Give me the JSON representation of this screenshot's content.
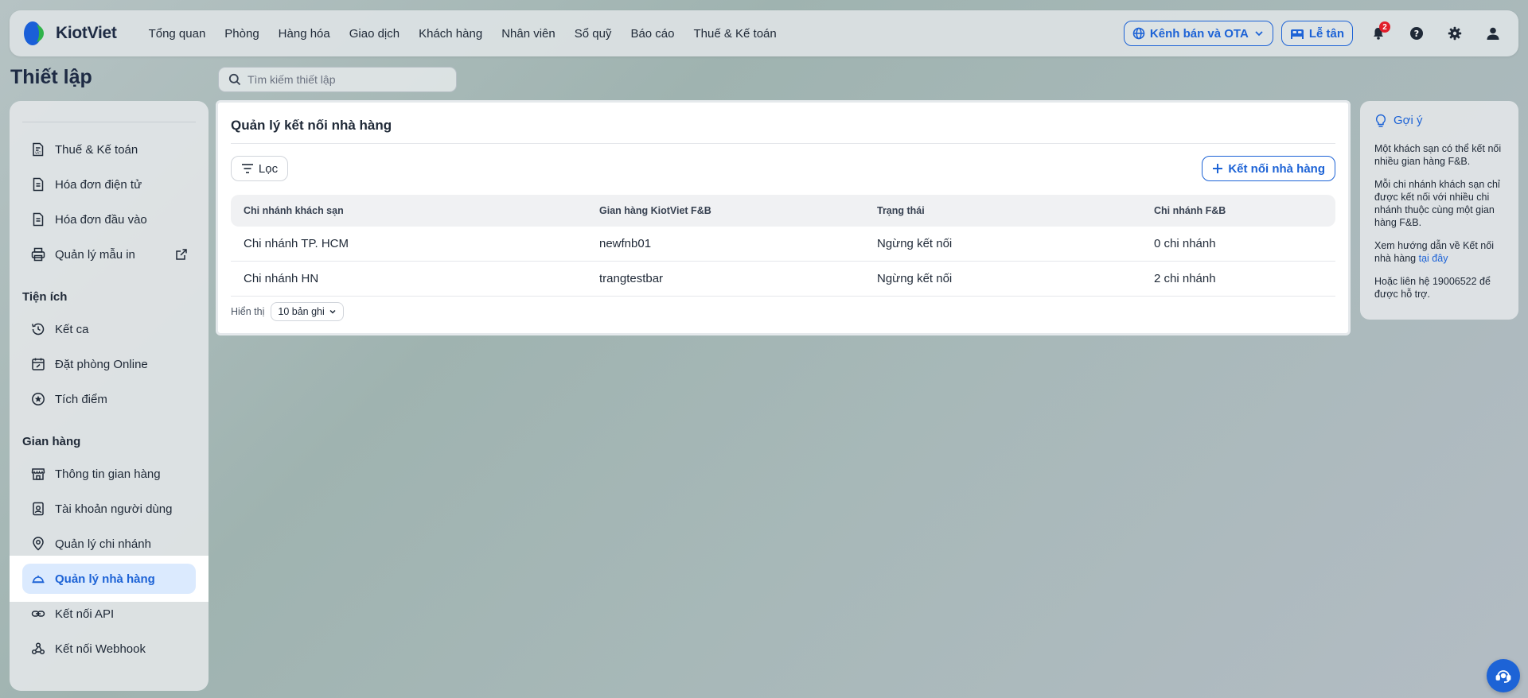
{
  "app": {
    "brand": "KiotViet",
    "brand_colors": {
      "primary": "#1d63d6",
      "logo_blue": "#1a5fd8",
      "logo_green": "#2fb34a",
      "badge_red": "#e11d2a"
    }
  },
  "topnav": {
    "menu": [
      {
        "label": "Tổng quan"
      },
      {
        "label": "Phòng"
      },
      {
        "label": "Hàng hóa"
      },
      {
        "label": "Giao dịch"
      },
      {
        "label": "Khách hàng"
      },
      {
        "label": "Nhân viên"
      },
      {
        "label": "Sổ quỹ"
      },
      {
        "label": "Báo cáo"
      },
      {
        "label": "Thuế & Kế toán"
      }
    ],
    "channel_button": "Kênh bán và OTA",
    "reception_button": "Lễ tân",
    "notification_count": "2",
    "icons": [
      "globe-icon",
      "chevron-down-icon",
      "bed-icon",
      "bell-icon",
      "help-icon",
      "gear-icon",
      "user-icon"
    ]
  },
  "page": {
    "title": "Thiết lập",
    "search_placeholder": "Tìm kiếm thiết lập"
  },
  "sidebar": {
    "group1": [
      {
        "label": "Thuế & Kế toán",
        "icon": "tax-doc-icon"
      },
      {
        "label": "Hóa đơn điện tử",
        "icon": "document-icon"
      },
      {
        "label": "Hóa đơn đầu vào",
        "icon": "document-icon"
      },
      {
        "label": "Quản lý mẫu in",
        "icon": "printer-icon"
      }
    ],
    "section_utilities": "Tiện ích",
    "utilities": [
      {
        "label": "Kết ca",
        "icon": "history-icon"
      },
      {
        "label": "Đặt phòng Online",
        "icon": "calendar-icon"
      },
      {
        "label": "Tích điểm",
        "icon": "star-circle-icon"
      }
    ],
    "section_store": "Gian hàng",
    "store": [
      {
        "label": "Thông tin gian hàng",
        "icon": "store-icon"
      },
      {
        "label": "Tài khoản người dùng",
        "icon": "user-badge-icon"
      },
      {
        "label": "Quản lý chi nhánh",
        "icon": "map-pin-icon"
      },
      {
        "label": "Quản lý nhà hàng",
        "icon": "cloche-icon",
        "active": true
      },
      {
        "label": "Kết nối API",
        "icon": "link-icon"
      },
      {
        "label": "Kết nối Webhook",
        "icon": "webhook-icon"
      }
    ]
  },
  "main": {
    "title": "Quản lý kết nối nhà hàng",
    "filter_label": "Lọc",
    "connect_label": "Kết nối nhà hàng",
    "columns": [
      "Chi nhánh khách sạn",
      "Gian hàng KiotViet F&B",
      "Trạng thái",
      "Chi nhánh F&B"
    ],
    "rows": [
      [
        "Chi nhánh TP. HCM",
        "newfnb01",
        "Ngừng kết nối",
        "0 chi nhánh"
      ],
      [
        "Chi nhánh HN",
        "trangtestbar",
        "Ngừng kết nối",
        "2 chi nhánh"
      ]
    ],
    "pager_label": "Hiển thị",
    "page_size": "10 bản ghi"
  },
  "hint": {
    "title": "Gợi ý",
    "p1": "Một khách sạn có thể kết nối nhiều gian hàng F&B.",
    "p2": "Mỗi chi nhánh khách sạn chỉ được kết nối với nhiều chi nhánh thuộc cùng một gian hàng F&B.",
    "p3_prefix": "Xem hướng dẫn về Kết nối nhà hàng ",
    "p3_link": "tại đây",
    "p4": "Hoặc liên hệ 19006522 để được hỗ trợ."
  }
}
